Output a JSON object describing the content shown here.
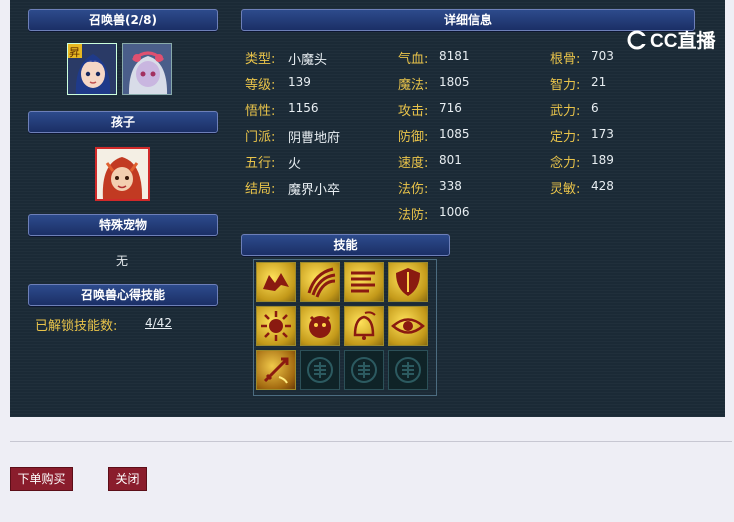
{
  "left": {
    "summon_header": "召唤兽(2/8)",
    "child_header": "孩子",
    "special_header": "特殊宠物",
    "special_value": "无",
    "skill_header": "召唤兽心得技能",
    "unlocked_label": "已解锁技能数:",
    "unlocked_value": "4/42",
    "summon_badge": "昇"
  },
  "detail_header": "详细信息",
  "skills_header": "技能",
  "watermark": "CC直播",
  "stats": {
    "col1": [
      {
        "label": "类型:",
        "value": "小魔头"
      },
      {
        "label": "等级:",
        "value": "139"
      },
      {
        "label": "悟性:",
        "value": "1156"
      },
      {
        "label": "门派:",
        "value": "阴曹地府"
      },
      {
        "label": "五行:",
        "value": "火"
      },
      {
        "label": "结局:",
        "value": "魔界小卒"
      }
    ],
    "col2": [
      {
        "label": "气血:",
        "value": "8181"
      },
      {
        "label": "魔法:",
        "value": "1805"
      },
      {
        "label": "攻击:",
        "value": "716"
      },
      {
        "label": "防御:",
        "value": "1085"
      },
      {
        "label": "速度:",
        "value": "801"
      },
      {
        "label": "法伤:",
        "value": "338"
      },
      {
        "label": "法防:",
        "value": "1006"
      }
    ],
    "col3": [
      {
        "label": "根骨:",
        "value": "703"
      },
      {
        "label": "智力:",
        "value": "21"
      },
      {
        "label": "武力:",
        "value": "6"
      },
      {
        "label": "定力:",
        "value": "173"
      },
      {
        "label": "念力:",
        "value": "189"
      },
      {
        "label": "灵敏:",
        "value": "428"
      }
    ]
  },
  "skill_icons": [
    "wolf-skill-icon",
    "claw-skill-icon",
    "scroll-skill-icon",
    "shield-skill-icon",
    "sun-skill-icon",
    "demon-skill-icon",
    "bell-skill-icon",
    "eye-skill-icon",
    "sword-skill-icon",
    "empty-slot-icon",
    "empty-slot-icon",
    "empty-slot-icon"
  ],
  "buttons": {
    "buy": "下单购买",
    "close": "关闭"
  }
}
